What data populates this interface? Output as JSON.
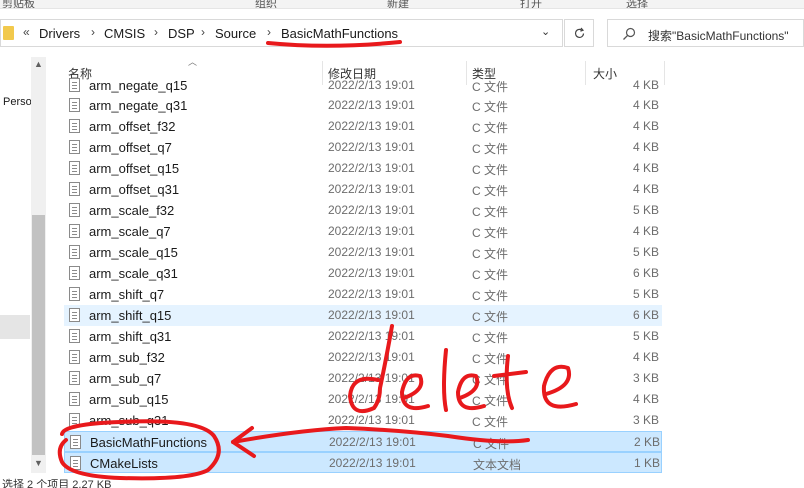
{
  "ribbon": {
    "groups": [
      "剪贴板",
      "组织",
      "新建",
      "打开",
      "选择"
    ]
  },
  "address": {
    "overflow": "«",
    "crumbs": [
      "Drivers",
      "CMSIS",
      "DSP",
      "Source",
      "BasicMathFunctions"
    ],
    "separator": "›",
    "dropdown": "⌄",
    "refresh": "↻"
  },
  "search": {
    "placeholder": "搜索\"BasicMathFunctions\""
  },
  "nav": {
    "partial_item": "Perso"
  },
  "columns": {
    "name": "名称",
    "date": "修改日期",
    "type": "类型",
    "size": "大小"
  },
  "files": [
    {
      "name": "arm_negate_q15",
      "date": "2022/2/13 19:01",
      "type": "C 文件",
      "size": "4 KB",
      "state": "normal"
    },
    {
      "name": "arm_negate_q31",
      "date": "2022/2/13 19:01",
      "type": "C 文件",
      "size": "4 KB",
      "state": "normal"
    },
    {
      "name": "arm_offset_f32",
      "date": "2022/2/13 19:01",
      "type": "C 文件",
      "size": "4 KB",
      "state": "normal"
    },
    {
      "name": "arm_offset_q7",
      "date": "2022/2/13 19:01",
      "type": "C 文件",
      "size": "4 KB",
      "state": "normal"
    },
    {
      "name": "arm_offset_q15",
      "date": "2022/2/13 19:01",
      "type": "C 文件",
      "size": "4 KB",
      "state": "normal"
    },
    {
      "name": "arm_offset_q31",
      "date": "2022/2/13 19:01",
      "type": "C 文件",
      "size": "4 KB",
      "state": "normal"
    },
    {
      "name": "arm_scale_f32",
      "date": "2022/2/13 19:01",
      "type": "C 文件",
      "size": "5 KB",
      "state": "normal"
    },
    {
      "name": "arm_scale_q7",
      "date": "2022/2/13 19:01",
      "type": "C 文件",
      "size": "4 KB",
      "state": "normal"
    },
    {
      "name": "arm_scale_q15",
      "date": "2022/2/13 19:01",
      "type": "C 文件",
      "size": "5 KB",
      "state": "normal"
    },
    {
      "name": "arm_scale_q31",
      "date": "2022/2/13 19:01",
      "type": "C 文件",
      "size": "6 KB",
      "state": "normal"
    },
    {
      "name": "arm_shift_q7",
      "date": "2022/2/13 19:01",
      "type": "C 文件",
      "size": "5 KB",
      "state": "normal"
    },
    {
      "name": "arm_shift_q15",
      "date": "2022/2/13 19:01",
      "type": "C 文件",
      "size": "6 KB",
      "state": "hover"
    },
    {
      "name": "arm_shift_q31",
      "date": "2022/2/13 19:01",
      "type": "C 文件",
      "size": "5 KB",
      "state": "normal"
    },
    {
      "name": "arm_sub_f32",
      "date": "2022/2/13 19:01",
      "type": "C 文件",
      "size": "4 KB",
      "state": "normal"
    },
    {
      "name": "arm_sub_q7",
      "date": "2022/2/13 19:01",
      "type": "C 文件",
      "size": "3 KB",
      "state": "normal"
    },
    {
      "name": "arm_sub_q15",
      "date": "2022/2/13 19:01",
      "type": "C 文件",
      "size": "4 KB",
      "state": "normal"
    },
    {
      "name": "arm_sub_q31",
      "date": "2022/2/13 19:01",
      "type": "C 文件",
      "size": "3 KB",
      "state": "normal"
    },
    {
      "name": "BasicMathFunctions",
      "date": "2022/2/13 19:01",
      "type": "C 文件",
      "size": "2 KB",
      "state": "selected"
    },
    {
      "name": "CMakeLists",
      "date": "2022/2/13 19:01",
      "type": "文本文档",
      "size": "1 KB",
      "state": "selected"
    }
  ],
  "status": {
    "text": "选择 2 个项目  2.27 KB"
  },
  "annotation": {
    "text": "delete",
    "color": "#e8191c"
  },
  "colors": {
    "selected_bg": "#cce8ff",
    "hover_bg": "#e5f3ff",
    "accent": "#0078d7"
  }
}
